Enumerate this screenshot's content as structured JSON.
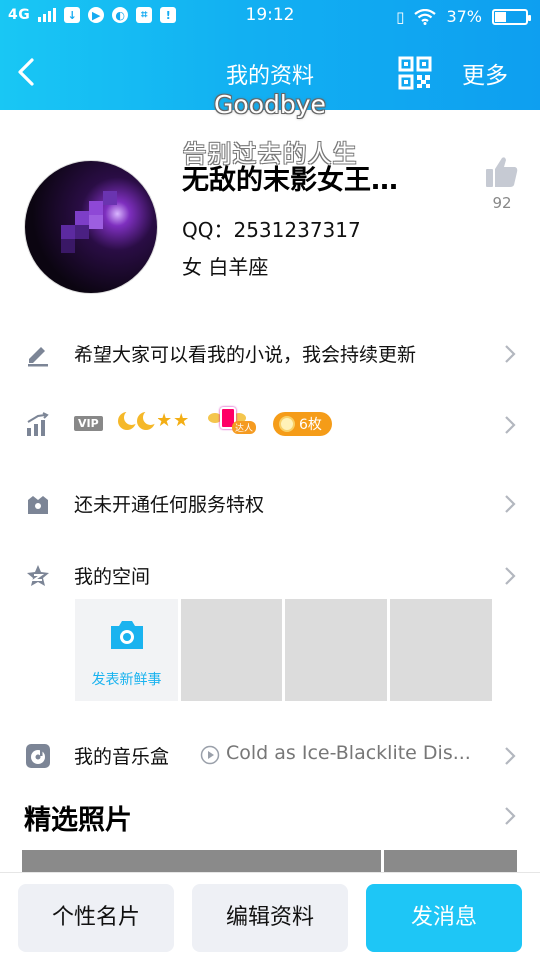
{
  "status_bar": {
    "network": "4G",
    "time": "19:12",
    "battery": "37%"
  },
  "header": {
    "title": "我的资料",
    "more_label": "更多",
    "overlay_title": "Goodbye",
    "overlay_subtitle": "告别过去的人生"
  },
  "profile": {
    "nickname": "无敌的末影女王…",
    "qq": "QQ：2531237317",
    "info": "女  白羊座",
    "likes": "92"
  },
  "rows": {
    "signature": "希望大家可以看我的小说，我会持续更新",
    "vip_badge": "VIP",
    "darren_label": "达人",
    "coins": "6枚",
    "privilege": "还未开通任何服务特权",
    "space": "我的空间",
    "post_label": "发表新鲜事",
    "music_label": "我的音乐盒",
    "music_track": "Cold as Ice-Blacklite Dis..."
  },
  "photos": {
    "title": "精选照片"
  },
  "bottom": {
    "card_label": "个性名片",
    "edit_label": "编辑资料",
    "message_label": "发消息"
  },
  "colors": {
    "accent": "#1ec6f6",
    "header_gradient_start": "#19c7f4",
    "header_gradient_end": "#0e9ff0",
    "coin": "#f59c18"
  }
}
